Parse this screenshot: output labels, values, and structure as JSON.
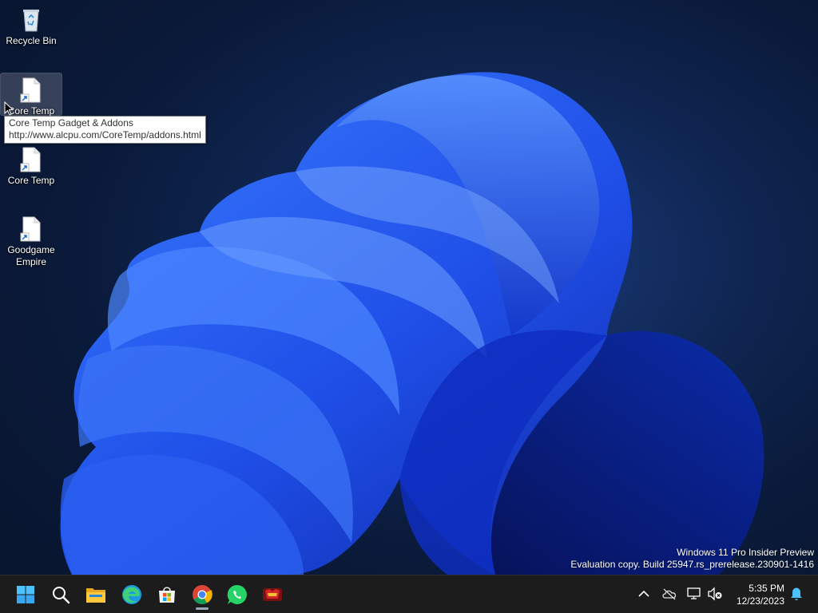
{
  "desktop": {
    "icons": [
      {
        "label": "Recycle Bin",
        "icon": "recycle-bin-icon"
      },
      {
        "label": "Core Temp",
        "icon": "shortcut-file-icon"
      },
      {
        "label": "Core Temp",
        "icon": "shortcut-file-icon"
      },
      {
        "label": "Goodgame Empire",
        "icon": "shortcut-file-icon"
      }
    ],
    "tooltip": {
      "line1": "Core Temp Gadget & Addons",
      "line2": "http://www.alcpu.com/CoreTemp/addons.html"
    }
  },
  "watermark": {
    "line1": "Windows 11 Pro Insider Preview",
    "line2": "Evaluation copy. Build 25947.rs_prerelease.230901-1416"
  },
  "taskbar": {
    "apps": [
      {
        "name": "Start",
        "icon": "windows-start-icon"
      },
      {
        "name": "Search",
        "icon": "search-icon"
      },
      {
        "name": "File Explorer",
        "icon": "folder-icon"
      },
      {
        "name": "Microsoft Edge",
        "icon": "edge-icon"
      },
      {
        "name": "Microsoft Store",
        "icon": "store-icon"
      },
      {
        "name": "Google Chrome",
        "icon": "chrome-icon",
        "active": true
      },
      {
        "name": "WhatsApp",
        "icon": "whatsapp-icon"
      },
      {
        "name": "Goodgame Empire",
        "icon": "game-icon"
      }
    ],
    "tray": {
      "icons": [
        "chevron-up-icon",
        "cloud-offline-icon",
        "network-icon",
        "volume-muted-icon",
        "notification-bell-icon"
      ],
      "time": "5:35 PM",
      "date": "12/23/2023"
    }
  },
  "colors": {
    "accent": "#1f5fff",
    "taskbar": "#1c1c1c",
    "wallpaper_dark": "#0a1a3a"
  }
}
